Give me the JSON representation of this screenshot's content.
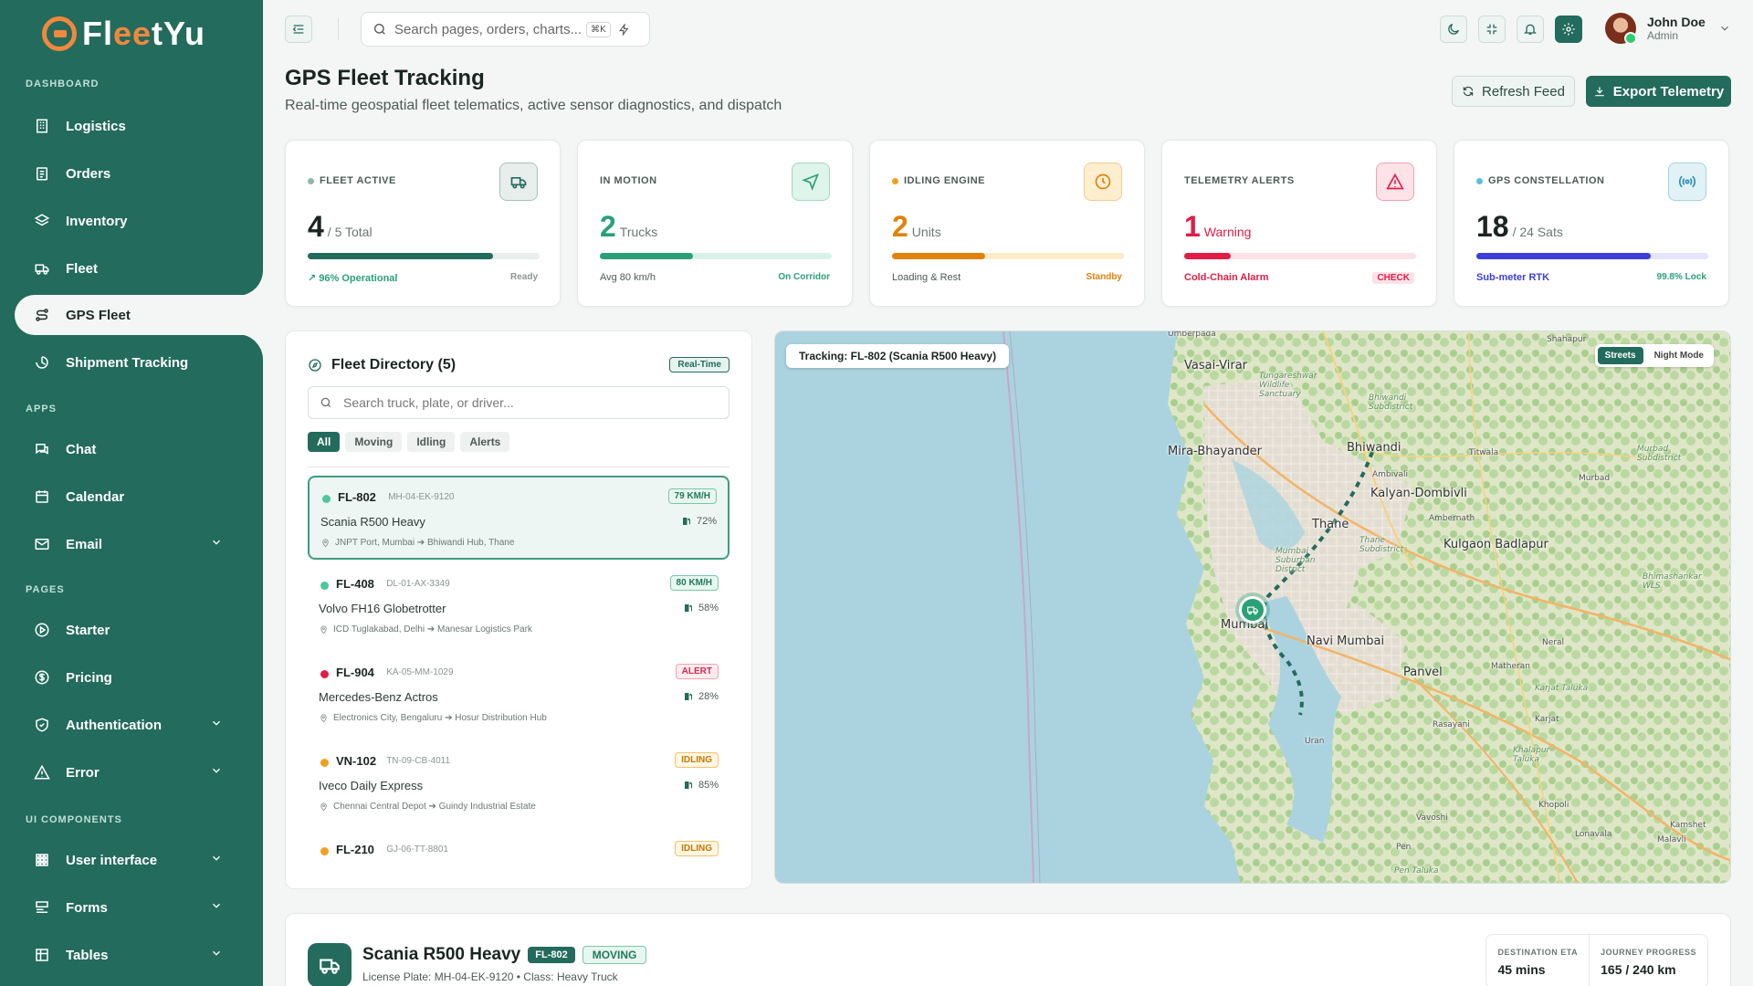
{
  "brand": {
    "prefix": "Fl",
    "accent": "ee",
    "suffix": "tYu"
  },
  "sidebar": {
    "sections": [
      {
        "label": "DASHBOARD"
      },
      {
        "label": "APPS"
      },
      {
        "label": "PAGES"
      },
      {
        "label": "UI COMPONENTS"
      }
    ],
    "items": [
      {
        "label": "Logistics",
        "icon": "building-icon"
      },
      {
        "label": "Orders",
        "icon": "clipboard-icon"
      },
      {
        "label": "Inventory",
        "icon": "layers-icon"
      },
      {
        "label": "Fleet",
        "icon": "truck-icon"
      },
      {
        "label": "GPS Fleet",
        "icon": "route-icon",
        "active": true
      },
      {
        "label": "Shipment Tracking",
        "icon": "shipment-icon"
      },
      {
        "label": "Chat",
        "icon": "chat-icon"
      },
      {
        "label": "Calendar",
        "icon": "calendar-icon"
      },
      {
        "label": "Email",
        "icon": "mail-icon",
        "expandable": true
      },
      {
        "label": "Starter",
        "icon": "play-icon"
      },
      {
        "label": "Pricing",
        "icon": "dollar-icon"
      },
      {
        "label": "Authentication",
        "icon": "shield-icon",
        "expandable": true
      },
      {
        "label": "Error",
        "icon": "warning-icon",
        "expandable": true
      },
      {
        "label": "User interface",
        "icon": "grid-icon",
        "expandable": true
      },
      {
        "label": "Forms",
        "icon": "form-icon",
        "expandable": true
      },
      {
        "label": "Tables",
        "icon": "table-icon",
        "expandable": true
      }
    ]
  },
  "header": {
    "search_placeholder": "Search pages, orders, charts...",
    "shortcut": "⌘K",
    "user": {
      "name": "John Doe",
      "role": "Admin"
    }
  },
  "page": {
    "title": "GPS Fleet Tracking",
    "subtitle": "Real-time geospatial fleet telematics, active sensor diagnostics, and dispatch",
    "refresh_label": "Refresh Feed",
    "export_label": "Export Telemetry"
  },
  "stats": [
    {
      "label": "FLEET ACTIVE",
      "value": "4",
      "unit": "/ 5 Total",
      "progress": 0.8,
      "foot_left": "↗ 96% Operational",
      "foot_right": "Ready",
      "color": "#236b5c",
      "track": "#e7eeec",
      "dot": "#8fb8ad",
      "icon": "truck-icon"
    },
    {
      "label": "IN MOTION",
      "value": "2",
      "unit": "Trucks",
      "progress": 0.4,
      "foot_left": "Avg 80 km/h",
      "foot_right": "On Corridor",
      "color": "#2aa076",
      "track": "#d8f2e7",
      "dot": null,
      "icon": "navigation-icon"
    },
    {
      "label": "IDLING ENGINE",
      "value": "2",
      "unit": "Units",
      "progress": 0.4,
      "foot_left": "Loading & Rest",
      "foot_right": "Standby",
      "color": "#e0820c",
      "track": "#fdecc8",
      "dot": "#f0a020",
      "icon": "clock-icon"
    },
    {
      "label": "TELEMETRY ALERTS",
      "value": "1",
      "unit": "Warning",
      "progress": 0.2,
      "foot_left": "Cold-Chain Alarm",
      "foot_right": "CHECK",
      "color": "#e11d48",
      "track": "#fde2e8",
      "dot": null,
      "icon": "alert-triangle-icon"
    },
    {
      "label": "GPS CONSTELLATION",
      "value": "18",
      "unit": "/ 24 Sats",
      "progress": 0.75,
      "foot_left": "Sub-meter RTK",
      "foot_right": "99.8% Lock",
      "color": "#3b3fd8",
      "track": "#e3e6fb",
      "dot": "#5fbfd6",
      "icon": "signal-icon"
    }
  ],
  "directory": {
    "title": "Fleet Directory (5)",
    "badge": "Real-Time",
    "search_placeholder": "Search truck, plate, or driver...",
    "filters": [
      "All",
      "Moving",
      "Idling",
      "Alerts"
    ],
    "vehicles": [
      {
        "id": "FL-802",
        "plate": "MH-04-EK-9120",
        "model": "Scania R500 Heavy",
        "route": "JNPT Port, Mumbai ➔ Bhiwandi Hub, Thane",
        "badge": "79 KM/H",
        "fuel": "72%",
        "status": "green",
        "dot": "#4fc79a"
      },
      {
        "id": "FL-408",
        "plate": "DL-01-AX-3349",
        "model": "Volvo FH16 Globetrotter",
        "route": "ICD Tuglakabad, Delhi ➔ Manesar Logistics Park",
        "badge": "80 KM/H",
        "fuel": "58%",
        "status": "green",
        "dot": "#4fc79a"
      },
      {
        "id": "FL-904",
        "plate": "KA-05-MM-1029",
        "model": "Mercedes-Benz Actros",
        "route": "Electronics City, Bengaluru ➔ Hosur Distribution Hub",
        "badge": "ALERT",
        "fuel": "28%",
        "status": "red",
        "dot": "#e11d48"
      },
      {
        "id": "VN-102",
        "plate": "TN-09-CB-4011",
        "model": "Iveco Daily Express",
        "route": "Chennai Central Depot ➔ Guindy Industrial Estate",
        "badge": "IDLING",
        "fuel": "85%",
        "status": "amber",
        "dot": "#f0a020"
      },
      {
        "id": "FL-210",
        "plate": "GJ-06-TT-8801",
        "model": "",
        "route": "",
        "badge": "IDLING",
        "fuel": "",
        "status": "amber",
        "dot": "#f0a020"
      }
    ]
  },
  "map": {
    "tracking_label": "Tracking: FL-802 (Scania R500 Heavy)",
    "modes": [
      "Streets",
      "Night Mode"
    ],
    "places": [
      {
        "name": "Umberpada",
        "cls": "sm"
      },
      {
        "name": "Shahapur",
        "cls": "sm"
      },
      {
        "name": "Vasai-Virar",
        "cls": ""
      },
      {
        "name": "Tungareshwar Wildlife Sanctuary",
        "cls": "it"
      },
      {
        "name": "Bhiwandi Subdistrict",
        "cls": "it"
      },
      {
        "name": "Mira-Bhayander",
        "cls": ""
      },
      {
        "name": "Bhiwandi",
        "cls": ""
      },
      {
        "name": "Titwala",
        "cls": "sm"
      },
      {
        "name": "Murbad Subdistrict",
        "cls": "it"
      },
      {
        "name": "Ambivali",
        "cls": "sm"
      },
      {
        "name": "Murbad",
        "cls": "sm"
      },
      {
        "name": "Kalyan-Dombivli",
        "cls": ""
      },
      {
        "name": "Thane",
        "cls": ""
      },
      {
        "name": "Ambernath",
        "cls": "sm"
      },
      {
        "name": "Thane Subdistrict",
        "cls": "it"
      },
      {
        "name": "Kulgaon Badlapur",
        "cls": ""
      },
      {
        "name": "Mumbai Suburban District",
        "cls": "it"
      },
      {
        "name": "Bhimashankar WLS",
        "cls": "it"
      },
      {
        "name": "Mumbai",
        "cls": ""
      },
      {
        "name": "Navi Mumbai",
        "cls": ""
      },
      {
        "name": "Neral",
        "cls": "sm"
      },
      {
        "name": "Panvel",
        "cls": ""
      },
      {
        "name": "Matheran",
        "cls": "sm"
      },
      {
        "name": "Karjat Taluka",
        "cls": "it"
      },
      {
        "name": "Karjat",
        "cls": "sm"
      },
      {
        "name": "Rasayani",
        "cls": "sm"
      },
      {
        "name": "Uran",
        "cls": "sm"
      },
      {
        "name": "Khalapur Taluka",
        "cls": "it"
      },
      {
        "name": "Khopoli",
        "cls": "sm"
      },
      {
        "name": "Vavoshi",
        "cls": "sm"
      },
      {
        "name": "Kamshet",
        "cls": "sm"
      },
      {
        "name": "Lonavala",
        "cls": "sm"
      },
      {
        "name": "Malavli",
        "cls": "sm"
      },
      {
        "name": "Pen",
        "cls": "sm"
      },
      {
        "name": "Pen Taluka",
        "cls": "it"
      }
    ]
  },
  "vehicle_detail": {
    "name": "Scania R500 Heavy",
    "id": "FL-802",
    "status": "MOVING",
    "meta": "License Plate: MH-04-EK-9120 • Class: Heavy Truck",
    "eta_label": "DESTINATION ETA",
    "eta_value": "45 mins",
    "progress_label": "JOURNEY PROGRESS",
    "progress_value": "165 / 240 km"
  }
}
